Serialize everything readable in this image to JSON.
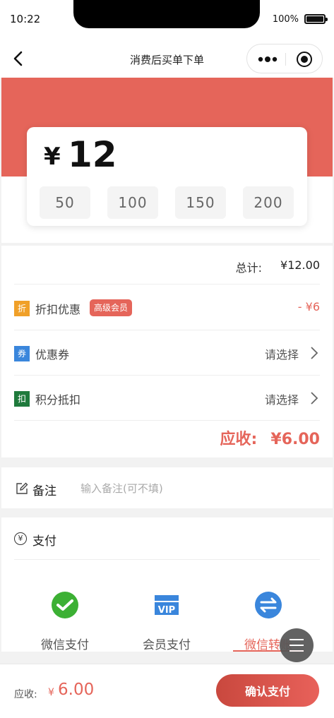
{
  "status_bar": {
    "time": "10:22",
    "battery": "100%"
  },
  "nav": {
    "title": "消费后买单下单"
  },
  "amount": {
    "currency": "¥",
    "value": "12"
  },
  "quick_amounts": [
    "50",
    "100",
    "150",
    "200"
  ],
  "summary": {
    "total_label": "总计:",
    "total_value": "¥12.00",
    "discount": {
      "icon_text": "折",
      "label": "折扣优惠",
      "tag": "高级会员",
      "value": "- ¥6",
      "icon_color": "#f0a028"
    },
    "coupon": {
      "icon_text": "券",
      "label": "优惠券",
      "action": "请选择",
      "icon_color": "#3a86dc"
    },
    "points": {
      "icon_text": "扣",
      "label": "积分抵扣",
      "action": "请选择",
      "icon_color": "#1f7a3c"
    },
    "due_label": "应收:",
    "due_value": "¥6.00"
  },
  "remark": {
    "label": "备注",
    "placeholder": "输入备注(可不填)"
  },
  "payment": {
    "label": "支付",
    "yen_icon": "¥",
    "methods": [
      {
        "name": "微信支付",
        "icon": "wechat-icon",
        "active": false
      },
      {
        "name": "会员支付",
        "icon": "vip-icon",
        "active": false
      },
      {
        "name": "微信转账",
        "icon": "transfer-icon",
        "active": true
      }
    ]
  },
  "bottom_bar": {
    "due_label": "应收:",
    "currency": "¥",
    "due_value": "6.00",
    "confirm_label": "确认支付"
  },
  "colors": {
    "accent": "#e5655a",
    "wechat": "#3cb034",
    "vip": "#3a86dc",
    "transfer": "#3a86dc"
  }
}
